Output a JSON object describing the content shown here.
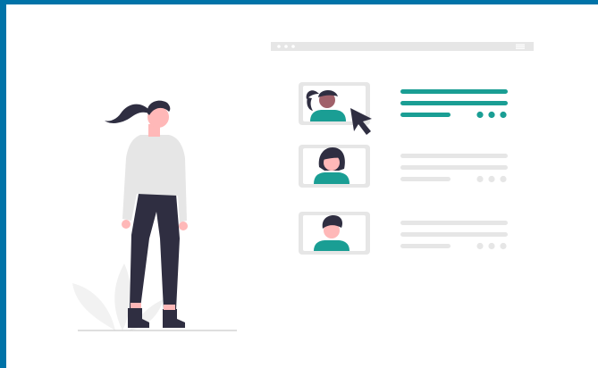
{
  "colors": {
    "frame_border": "#0073a8",
    "accent": "#1a9e94",
    "line_light": "#e6e6e6",
    "line_lighter": "#ebebeb",
    "card_border": "#e6e6e6",
    "dark": "#2f2e41",
    "skin": "#ffb8b8",
    "sweater": "#e6e6e6"
  },
  "browser_bar": {
    "dots_icon": "window-dots-icon",
    "menu_icon": "hamburger-menu-icon"
  },
  "profiles": [
    {
      "name": "profile-card-woman-ponytail",
      "selected": true
    },
    {
      "name": "profile-card-woman-short-hair",
      "selected": false
    },
    {
      "name": "profile-card-man",
      "selected": false
    }
  ],
  "cursor_icon": "mouse-pointer-icon"
}
